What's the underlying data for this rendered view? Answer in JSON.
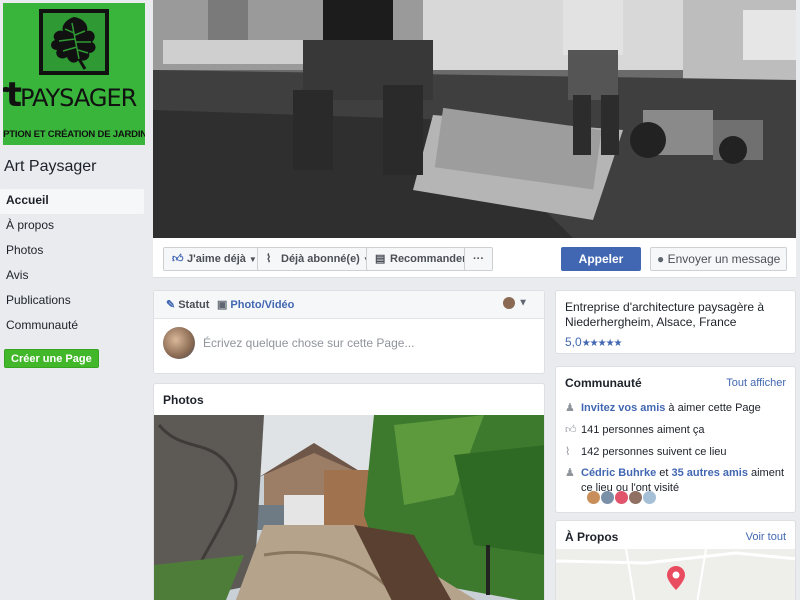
{
  "logo": {
    "brand_small": "rt",
    "brand_large": "PAYSAGER",
    "tagline": "EPTION ET CRÉATION DE JARDINS"
  },
  "page": {
    "name": "Art Paysager"
  },
  "nav": {
    "items": [
      {
        "label": "Accueil"
      },
      {
        "label": "À propos"
      },
      {
        "label": "Photos"
      },
      {
        "label": "Avis"
      },
      {
        "label": "Publications"
      },
      {
        "label": "Communauté"
      }
    ],
    "create_page": "Créer une Page"
  },
  "actions": {
    "like": "J'aime déjà",
    "follow": "Déjà abonné(e)",
    "recommend": "Recommander",
    "more": "···",
    "call": "Appeler",
    "message": "Envoyer un message"
  },
  "composer": {
    "tab_status": "Statut",
    "tab_photo": "Photo/Vidéo",
    "placeholder": "Écrivez quelque chose sur cette Page..."
  },
  "photos": {
    "title": "Photos"
  },
  "about": {
    "description": "Entreprise d'architecture paysagère à Niederhergheim, Alsace, France",
    "rating": "5,0",
    "stars": "★★★★★"
  },
  "community": {
    "title": "Communauté",
    "see_all": "Tout afficher",
    "invite_link": "Invitez vos amis",
    "invite_rest": " à aimer cette Page",
    "likes": "141 personnes aiment ça",
    "follows": "142 personnes suivent ce lieu",
    "friend_name": "Cédric Buhrke",
    "friend_mid": " et ",
    "friend_others": "35 autres amis",
    "friend_rest": " aiment ce lieu ou l'ont visité"
  },
  "apropos": {
    "title": "À Propos",
    "see_all": "Voir tout"
  },
  "colors": {
    "accent": "#4267b2",
    "green": "#42b72a",
    "logo_green": "#39b53b"
  }
}
